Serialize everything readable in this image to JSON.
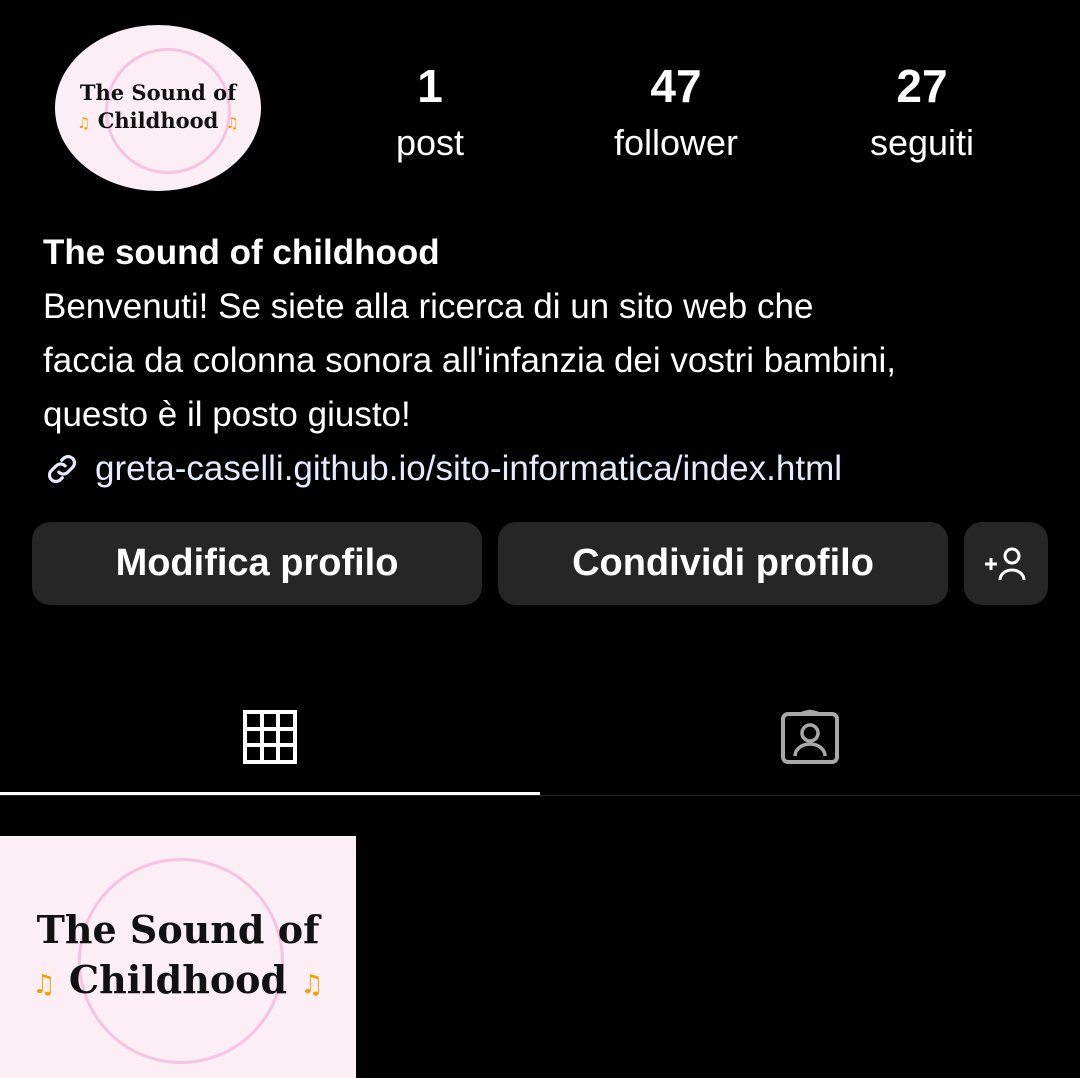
{
  "profile": {
    "logo_line1": "The Sound of",
    "logo_line2": "Childhood",
    "display_name": "The sound of childhood",
    "bio_lines": [
      "Benvenuti! Se siete alla ricerca di un sito web che",
      "faccia da colonna sonora all'infanzia dei vostri bambini,",
      "questo è il posto giusto!"
    ],
    "link": "greta-caselli.github.io/sito-informatica/index.html"
  },
  "stats": [
    {
      "value": "1",
      "label": "post"
    },
    {
      "value": "47",
      "label": "follower"
    },
    {
      "value": "27",
      "label": "seguiti"
    }
  ],
  "buttons": {
    "edit_profile": "Modifica profilo",
    "share_profile": "Condividi profilo",
    "discover_people_icon": "add-person-icon"
  },
  "tabs": [
    {
      "icon": "grid-icon",
      "active": true
    },
    {
      "icon": "tagged-person-icon",
      "active": false
    }
  ],
  "posts": [
    {
      "logo_line1": "The Sound of",
      "logo_line2": "Childhood"
    }
  ],
  "colors": {
    "background": "#000000",
    "button": "#262626",
    "logo_bg": "#fbeef5",
    "logo_ring": "#f2b6d9",
    "link": "#e6ecff"
  }
}
